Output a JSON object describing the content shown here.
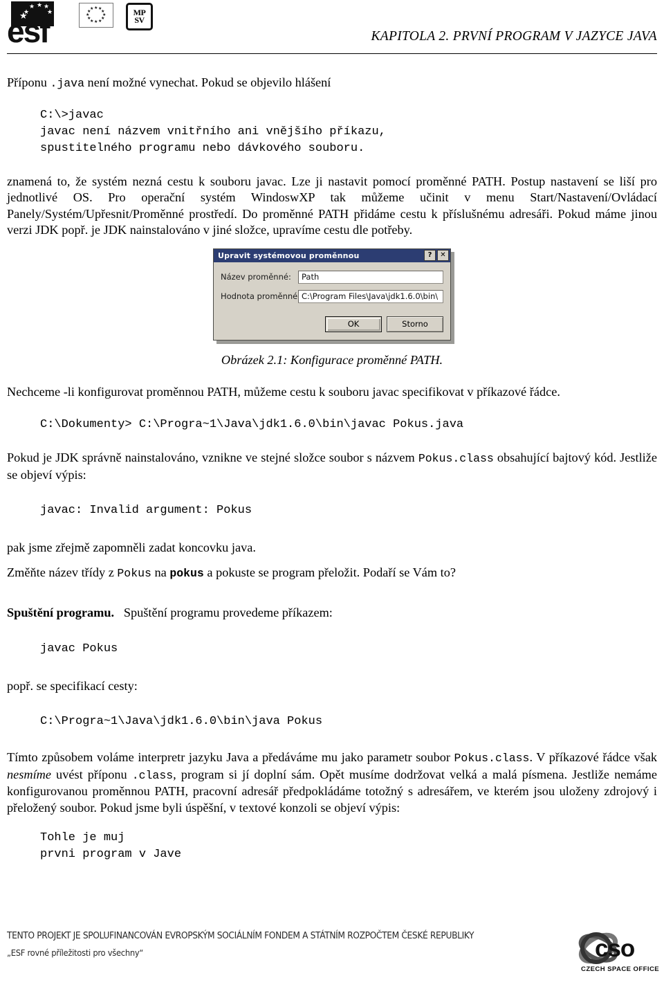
{
  "header": {
    "chapter_title": "KAPITOLA 2. PRVNÍ PROGRAM V JAZYCE JAVA",
    "logos": {
      "esf_word": "esf",
      "mpsv_line1": "MP",
      "mpsv_line2": "SV"
    }
  },
  "content": {
    "para1_a": "Příponu ",
    "para1_code": ".java",
    "para1_b": " není možné vynechat. Pokud se objevilo hlášení",
    "code_block1": "C:\\>javac\njavac není názvem vnitřního ani vnějšího příkazu,\nspustitelného programu nebo dávkového souboru.",
    "para2": "znamená to, že systém nezná cestu k souboru javac. Lze ji nastavit pomocí proměnné PATH. Postup nastavení se liší pro jednotlivé OS. Pro operační systém WindoswXP tak můžeme učinit v menu Start/Nastavení/Ovládací Panely/Systém/Upřesnit/Proměnné prostředí. Do proměnné PATH přidáme cestu k příslušnému adresáři. Pokud máme jinou verzi JDK popř. je JDK nainstalováno v jiné složce, upravíme cestu dle potřeby.",
    "figure_caption": "Obrázek 2.1: Konfigurace proměnné PATH.",
    "para3": "Nechceme -li konfigurovat proměnnou PATH, můžeme cestu k souboru javac specifikovat v příkazové řádce.",
    "code_block2": "C:\\Dokumenty> C:\\Progra~1\\Java\\jdk1.6.0\\bin\\javac Pokus.java",
    "para4_a": "Pokud je JDK správně nainstalováno, vznikne ve stejné složce soubor s názvem ",
    "para4_code": "Pokus.class",
    "para4_b": " obsahující bajtový kód. Jestliže se objeví výpis:",
    "code_block3": "javac: Invalid argument: Pokus",
    "para5": "pak jsme zřejmě zapomněli zadat koncovku java.",
    "para6_a": "Změňte název třídy z ",
    "para6_code1": "Pokus",
    "para6_b": " na ",
    "para6_code2": "pokus",
    "para6_c": " a pokuste se program přeložit. Podaří se Vám to?",
    "para7_bold": "Spuštění programu.",
    "para7_rest": "Spuštění programu provedeme příkazem:",
    "code_block4": "javac Pokus",
    "para8": "popř. se specifikací cesty:",
    "code_block5": "C:\\Progra~1\\Java\\jdk1.6.0\\bin\\java Pokus",
    "para9_a": "Tímto způsobem voláme interpretr jazyku Java a předáváme mu jako parametr soubor ",
    "para9_code1": "Pokus.class",
    "para9_b": ". V příkazové řádce však ",
    "para9_italic": "nesmíme",
    "para9_c": " uvést příponu ",
    "para9_code2": ".class",
    "para9_d": ", program si jí doplní sám. Opět musíme dodržovat velká a malá písmena. Jestliže nemáme konfigurovanou proměnnou PATH, pracovní adresář předpokládáme totožný s adresářem, ve kterém jsou uloženy zdrojový i přeložený soubor. Pokud jsme byli úspěšní, v textové konzoli se objeví výpis:",
    "code_block6": "Tohle je muj\nprvni program v Jave"
  },
  "dialog": {
    "title": "Upravit systémovou proměnnou",
    "help_button": "?",
    "close_button": "✕",
    "label_name": "Název proměnné:",
    "value_name": "Path",
    "label_value": "Hodnota proměnné:",
    "value_value": "C:\\Program Files\\Java\\jdk1.6.0\\bin\\",
    "ok_label": "OK",
    "cancel_label": "Storno",
    "titlebar_color": "#2c3d72",
    "face_color": "#d6d2c8"
  },
  "footer": {
    "line1": "TENTO PROJEKT JE SPOLUFINANCOVÁN EVROPSKÝM SOCIÁLNÍM FONDEM A STÁTNÍM ROZPOČTEM ČESKÉ REPUBLIKY",
    "line2": "„ESF rovné příležitosti pro všechny“",
    "cso_word": "cso",
    "cso_sub": "CZECH SPACE OFFICE"
  }
}
